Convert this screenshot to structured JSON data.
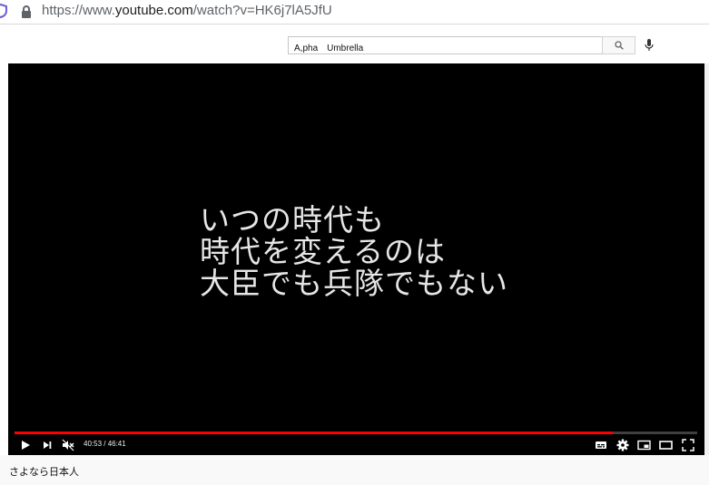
{
  "browser": {
    "url_prefix": "https://www.",
    "url_host": "youtube.com",
    "url_path": "/watch?v=HK6j7lA5JfU"
  },
  "search": {
    "value": "A,pha　Umbrella",
    "placeholder": "Search"
  },
  "player": {
    "subtitle_lines": [
      "いつの時代も",
      "時代を変えるのは",
      "大臣でも兵隊でもない"
    ],
    "time_display": "40:53 / 46:41",
    "progress_fraction": 0.876,
    "progress_color": "#ff0000"
  },
  "video": {
    "title": "さよなら日本人"
  },
  "icons": {
    "address": [
      "shield-icon",
      "lock-icon"
    ],
    "header": [
      "search-icon",
      "mic-icon"
    ],
    "controls": [
      "play-icon",
      "next-icon",
      "mute-icon",
      "subtitles-icon",
      "settings-icon",
      "miniplayer-icon",
      "theater-icon",
      "fullscreen-icon"
    ]
  }
}
